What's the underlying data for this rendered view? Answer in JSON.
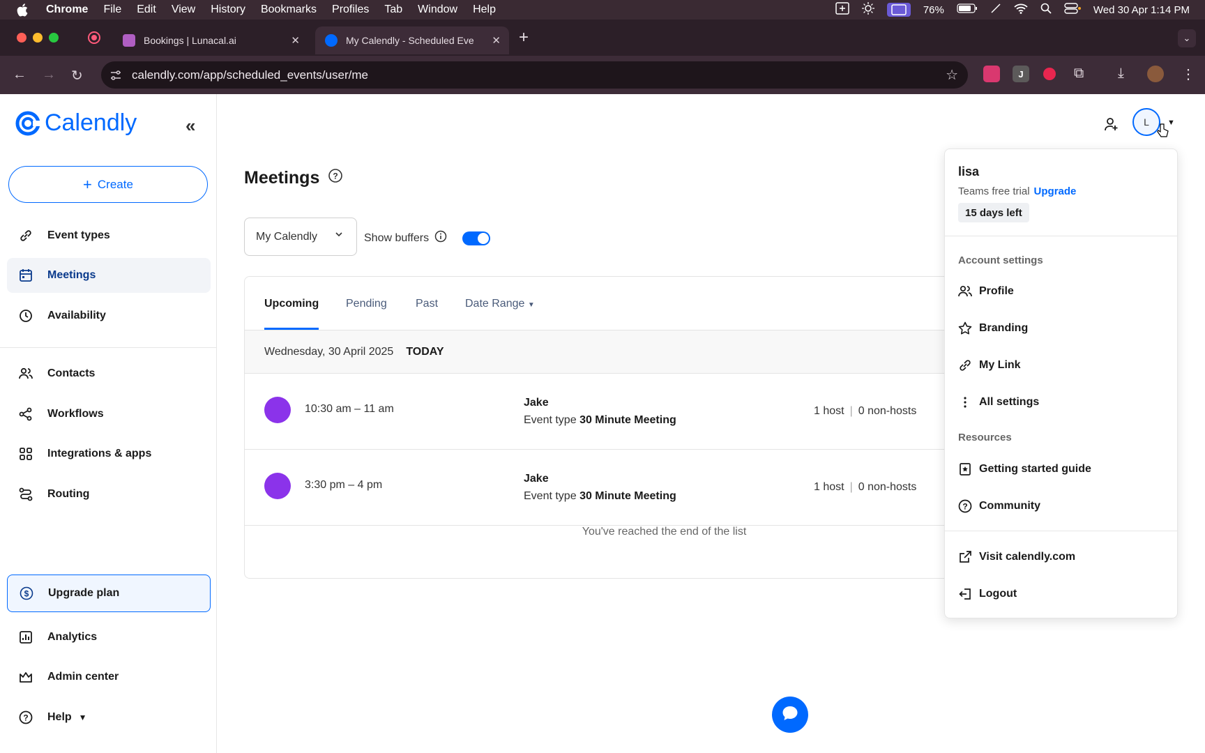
{
  "menubar": {
    "app": "Chrome",
    "items": [
      "File",
      "Edit",
      "View",
      "History",
      "Bookmarks",
      "Profiles",
      "Tab",
      "Window",
      "Help"
    ],
    "battery": "76%",
    "datetime": "Wed 30 Apr  1:14 PM"
  },
  "browser": {
    "tabs": [
      {
        "title": "Bookings | Lunacal.ai"
      },
      {
        "title": "My Calendly - Scheduled Eve"
      }
    ],
    "url": "calendly.com/app/scheduled_events/user/me"
  },
  "sidebar": {
    "logo": "Calendly",
    "create_label": "Create",
    "items": [
      {
        "label": "Event types",
        "icon": "link-icon"
      },
      {
        "label": "Meetings",
        "icon": "calendar-icon"
      },
      {
        "label": "Availability",
        "icon": "clock-icon"
      },
      {
        "label": "Contacts",
        "icon": "people-icon"
      },
      {
        "label": "Workflows",
        "icon": "workflow-icon"
      },
      {
        "label": "Integrations & apps",
        "icon": "apps-icon"
      },
      {
        "label": "Routing",
        "icon": "routing-icon"
      }
    ],
    "bottom": [
      {
        "label": "Upgrade plan",
        "icon": "dollar-icon"
      },
      {
        "label": "Analytics",
        "icon": "chart-icon"
      },
      {
        "label": "Admin center",
        "icon": "crown-icon"
      },
      {
        "label": "Help",
        "icon": "help-icon"
      }
    ]
  },
  "main": {
    "title": "Meetings",
    "calendar_select": "My Calendly",
    "show_buffers": "Show buffers",
    "tabs": [
      "Upcoming",
      "Pending",
      "Past",
      "Date Range"
    ],
    "day": "Wednesday, 30 April 2025",
    "today": "TODAY",
    "events": [
      {
        "time": "10:30 am – 11 am",
        "invitee": "Jake",
        "type_prefix": "Event type",
        "type": "30 Minute Meeting",
        "hosts": "1 host",
        "non_hosts": "0 non-hosts"
      },
      {
        "time": "3:30 pm – 4 pm",
        "invitee": "Jake",
        "type_prefix": "Event type",
        "type": "30 Minute Meeting",
        "hosts": "1 host",
        "non_hosts": "0 non-hosts"
      }
    ],
    "end_of_list": "You've reached the end of the list"
  },
  "account": {
    "avatar_initial": "L",
    "user": "lisa",
    "trial": "Teams free trial",
    "upgrade": "Upgrade",
    "days_left": "15 days left",
    "settings_heading": "Account settings",
    "settings": [
      "Profile",
      "Branding",
      "My Link",
      "All settings"
    ],
    "resources_heading": "Resources",
    "resources": [
      "Getting started guide",
      "Community"
    ],
    "visit": "Visit calendly.com",
    "logout": "Logout"
  },
  "colors": {
    "accent": "#0069ff",
    "event_dot": "#8b33ea"
  }
}
